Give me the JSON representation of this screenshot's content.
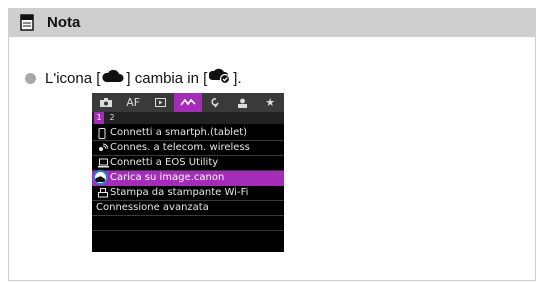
{
  "note": {
    "title": "Nota",
    "text_before": "L'icona [",
    "text_middle": "] cambia in [",
    "text_after": "].",
    "icon_from": "cloud-icon",
    "icon_to": "cloud-check-icon"
  },
  "screen": {
    "tabs": [
      {
        "label": "📷",
        "icon": "camera-icon"
      },
      {
        "label": "AF",
        "icon": "af-label"
      },
      {
        "label": "▶",
        "icon": "playback-icon"
      },
      {
        "label": "〰",
        "icon": "wireless-icon",
        "active": true
      },
      {
        "label": "🔧",
        "icon": "wrench-icon"
      },
      {
        "label": "⚙",
        "icon": "custom-function-icon"
      },
      {
        "label": "★",
        "icon": "star-icon"
      }
    ],
    "pages": [
      "1",
      "2"
    ],
    "items": [
      {
        "label": "Connetti a smartph.(tablet)",
        "icon": "smartphone-icon"
      },
      {
        "label": "Connes. a telecom. wireless",
        "icon": "remote-icon"
      },
      {
        "label": "Connetti a EOS Utility",
        "icon": "laptop-icon"
      },
      {
        "label": "Carica su image.canon",
        "icon": "cloud-check-icon",
        "selected": true
      },
      {
        "label": "Stampa da stampante Wi-Fi",
        "icon": "printer-icon"
      },
      {
        "label": "Connessione avanzata",
        "icon": ""
      }
    ]
  },
  "colors": {
    "accent": "#a32cb8",
    "header_bg": "#cfcfcf",
    "highlight_ring": "#2a7fd6"
  }
}
